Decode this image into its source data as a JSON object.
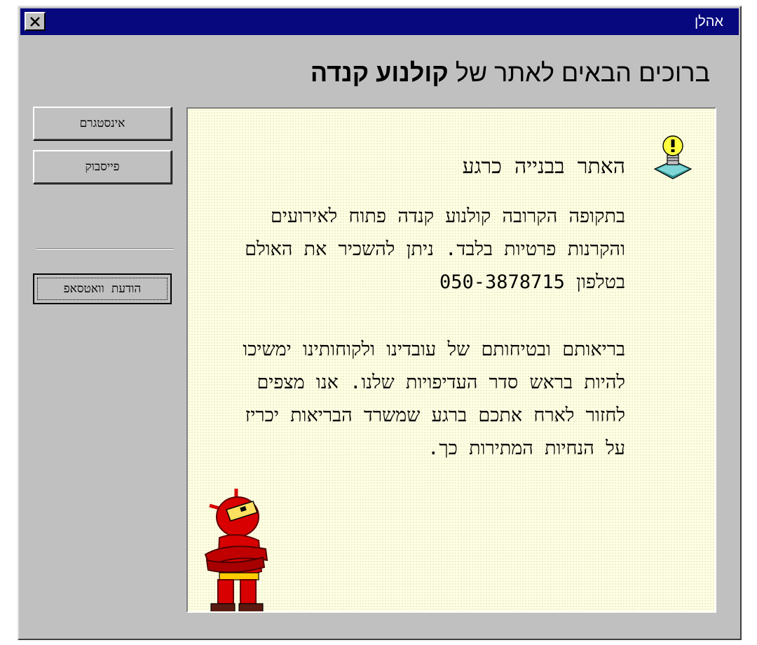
{
  "window": {
    "title": "אהלן",
    "close_label": "X"
  },
  "header": {
    "welcome_prefix": "ברוכים הבאים לאתר של ",
    "site_name": "קולנוע קנדה"
  },
  "sidebar": {
    "buttons": [
      {
        "label": "אינסטגרם"
      },
      {
        "label": "פייסבוק"
      },
      {
        "label": "הודעת וואטסאפ"
      }
    ]
  },
  "panel": {
    "heading": "האתר בבנייה כרגע",
    "paragraph1": "בתקופה הקרובה קולנוע קנדה פתוח לאירועים והקרנות פרטיות בלבד. ניתן להשכיר את האולם בטלפון 050-3878715",
    "paragraph2": "בריאותם ובטיחותם של עובדינו ולקוחותינו ימשיכו להיות בראש סדר העדיפויות שלנו. אנו מצפים לחזור לארח אתכם ברגע שמשרד הבריאות יכריז על הנחיות המתירות כך."
  },
  "icons": {
    "info": "lightbulb-icon",
    "mascot": "robot-mascot-icon",
    "close": "close-icon"
  },
  "colors": {
    "titlebar": "#08087e",
    "window_bg": "#c0c0c0",
    "panel_bg": "#ffffe4",
    "mascot_red": "#d80000"
  }
}
